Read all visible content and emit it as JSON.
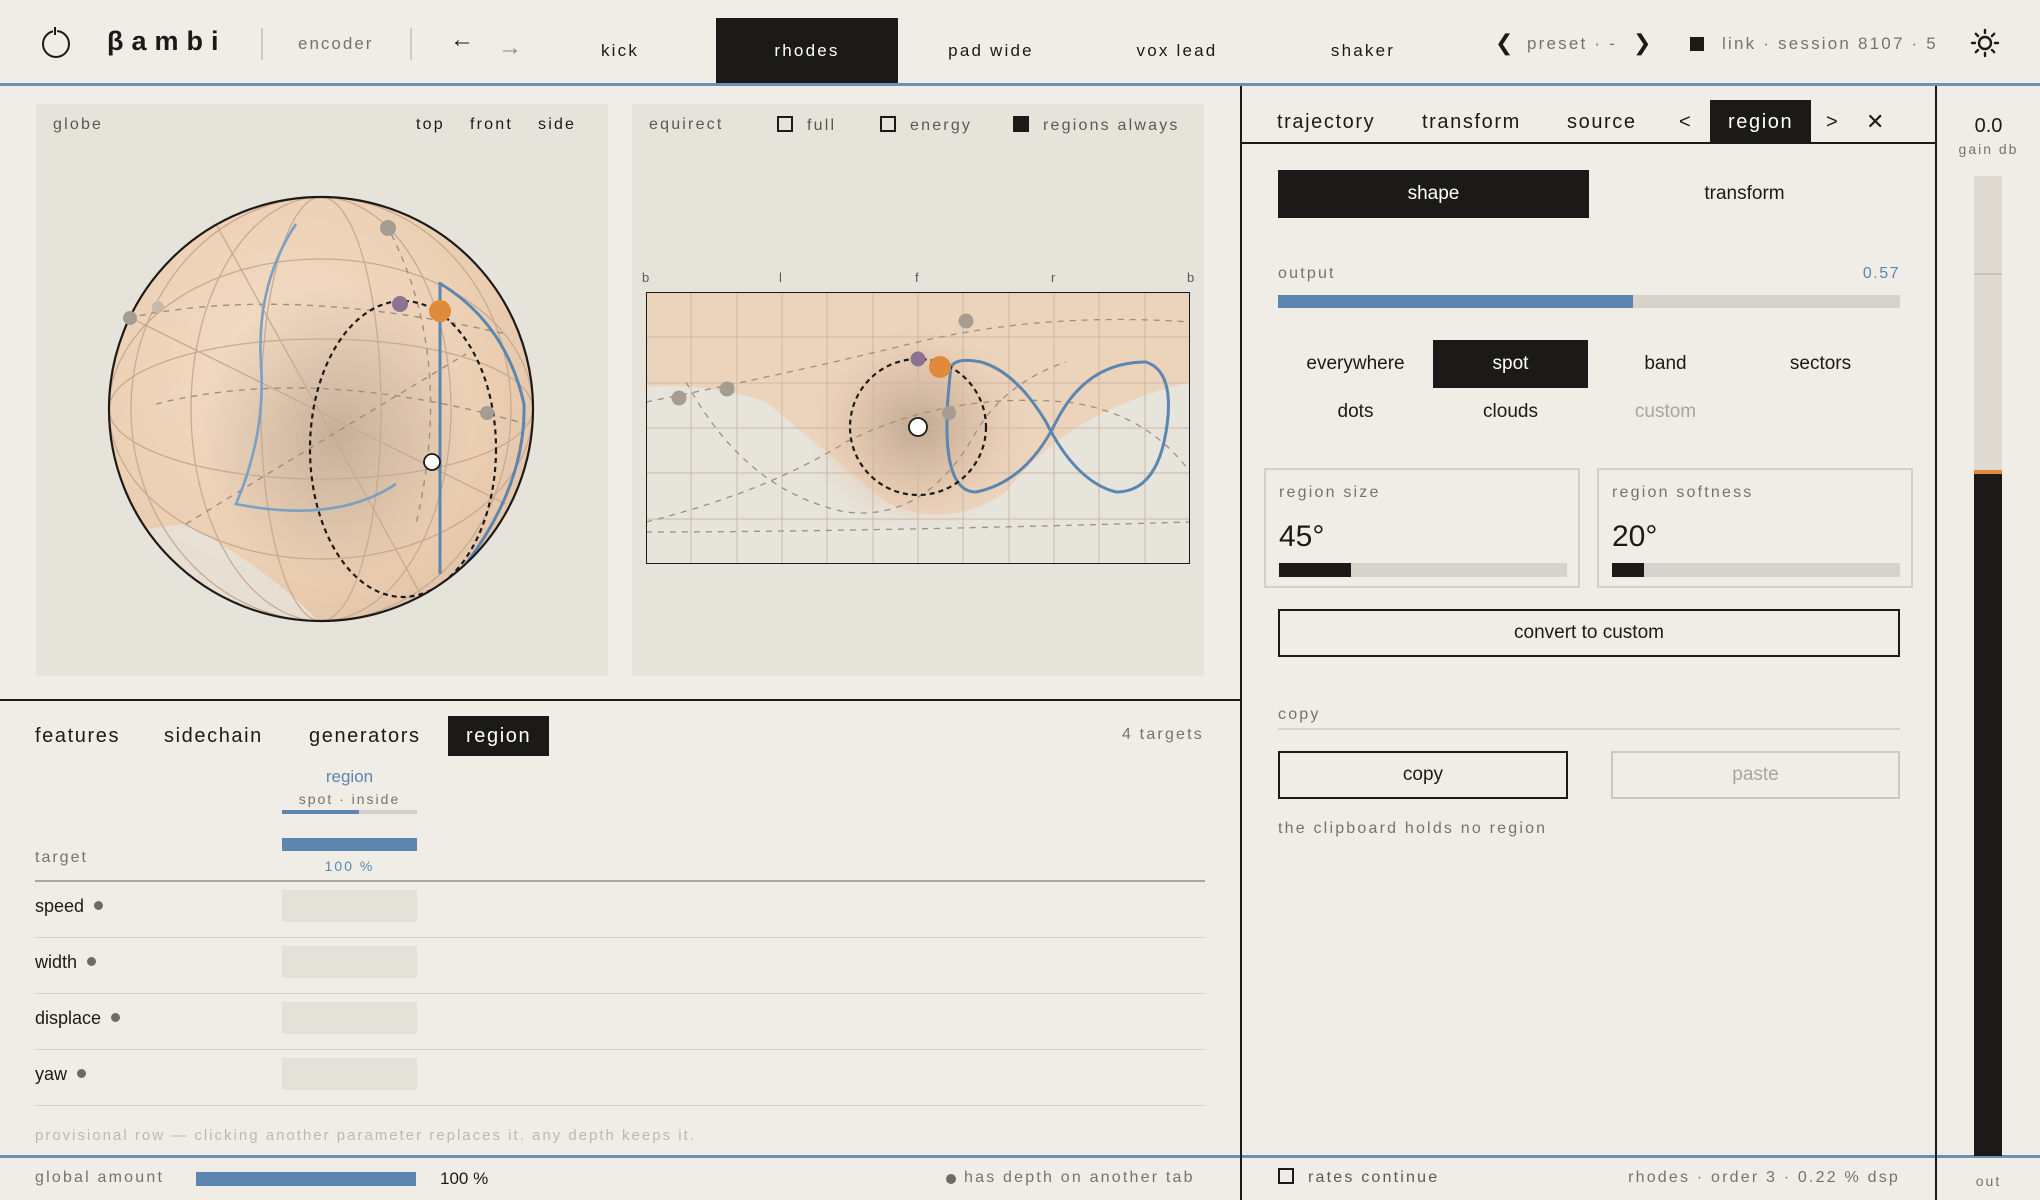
{
  "header": {
    "app_name": "βambi",
    "encoder_label": "encoder",
    "back_arrow": "←",
    "forward_arrow": "→",
    "tracks": [
      "kick",
      "rhodes",
      "pad wide",
      "vox lead",
      "shaker"
    ],
    "active_track": 1,
    "preset_label": "preset · -",
    "prev_glyph": "❮",
    "next_glyph": "❯",
    "link_label": "link · session 8107 · 5"
  },
  "globe": {
    "label": "globe",
    "views": [
      "top",
      "front",
      "side"
    ]
  },
  "equirect": {
    "label": "equirect",
    "opt_full": "full",
    "opt_energy": "energy",
    "opt_regions": "regions always",
    "full_on": false,
    "energy_on": false,
    "regions_on": true,
    "axis_labels": [
      "b",
      "l",
      "f",
      "r",
      "b"
    ]
  },
  "lower": {
    "tabs": [
      "features",
      "sidechain",
      "generators",
      "region"
    ],
    "active_tab": 3,
    "targets_count": "4 targets",
    "column_title": "region",
    "column_sub": "spot · inside",
    "column_sub_level": 0.57,
    "target_label": "target",
    "depth_value": "100 %",
    "depth_level": 1.0,
    "rows": [
      "speed",
      "width",
      "displace",
      "yaw"
    ],
    "provisional_note": "provisional row — clicking another parameter replaces it. any depth keeps it."
  },
  "footer": {
    "global_amount_label": "global amount",
    "global_amount_value": "100 %",
    "global_amount_level": 1.0,
    "depth_note": "has depth on another tab",
    "rates_label": "rates continue",
    "rates_on": false,
    "status": "rhodes · order 3 · 0.22 % dsp"
  },
  "right": {
    "tabs": [
      "trajectory",
      "transform",
      "source",
      "region"
    ],
    "active_tab": 3,
    "lt_glyph": "<",
    "gt_glyph": ">",
    "close_glyph": "✕",
    "mode_shape": "shape",
    "mode_transform": "transform",
    "output_label": "output",
    "output_value": "0.57",
    "output_level": 0.57,
    "shapes_row1": [
      "everywhere",
      "spot",
      "band",
      "sectors"
    ],
    "shapes_row2": [
      "dots",
      "clouds",
      "custom"
    ],
    "active_shape": "spot",
    "region_size_label": "region size",
    "region_size_value": "45°",
    "region_size_level": 0.25,
    "region_softness_label": "region softness",
    "region_softness_value": "20°",
    "region_softness_level": 0.11,
    "convert_label": "convert to custom",
    "copy_section_label": "copy",
    "copy_button": "copy",
    "paste_button": "paste",
    "clipboard_note": "the clipboard holds no region"
  },
  "meter": {
    "gain_value": "0.0",
    "gain_label": "gain db",
    "out_label": "out",
    "level": 0.7
  },
  "colors": {
    "accent_blue": "#5b86b0",
    "orange": "#e08a3c",
    "purple": "#8a7393",
    "ink": "#1b1a18"
  }
}
